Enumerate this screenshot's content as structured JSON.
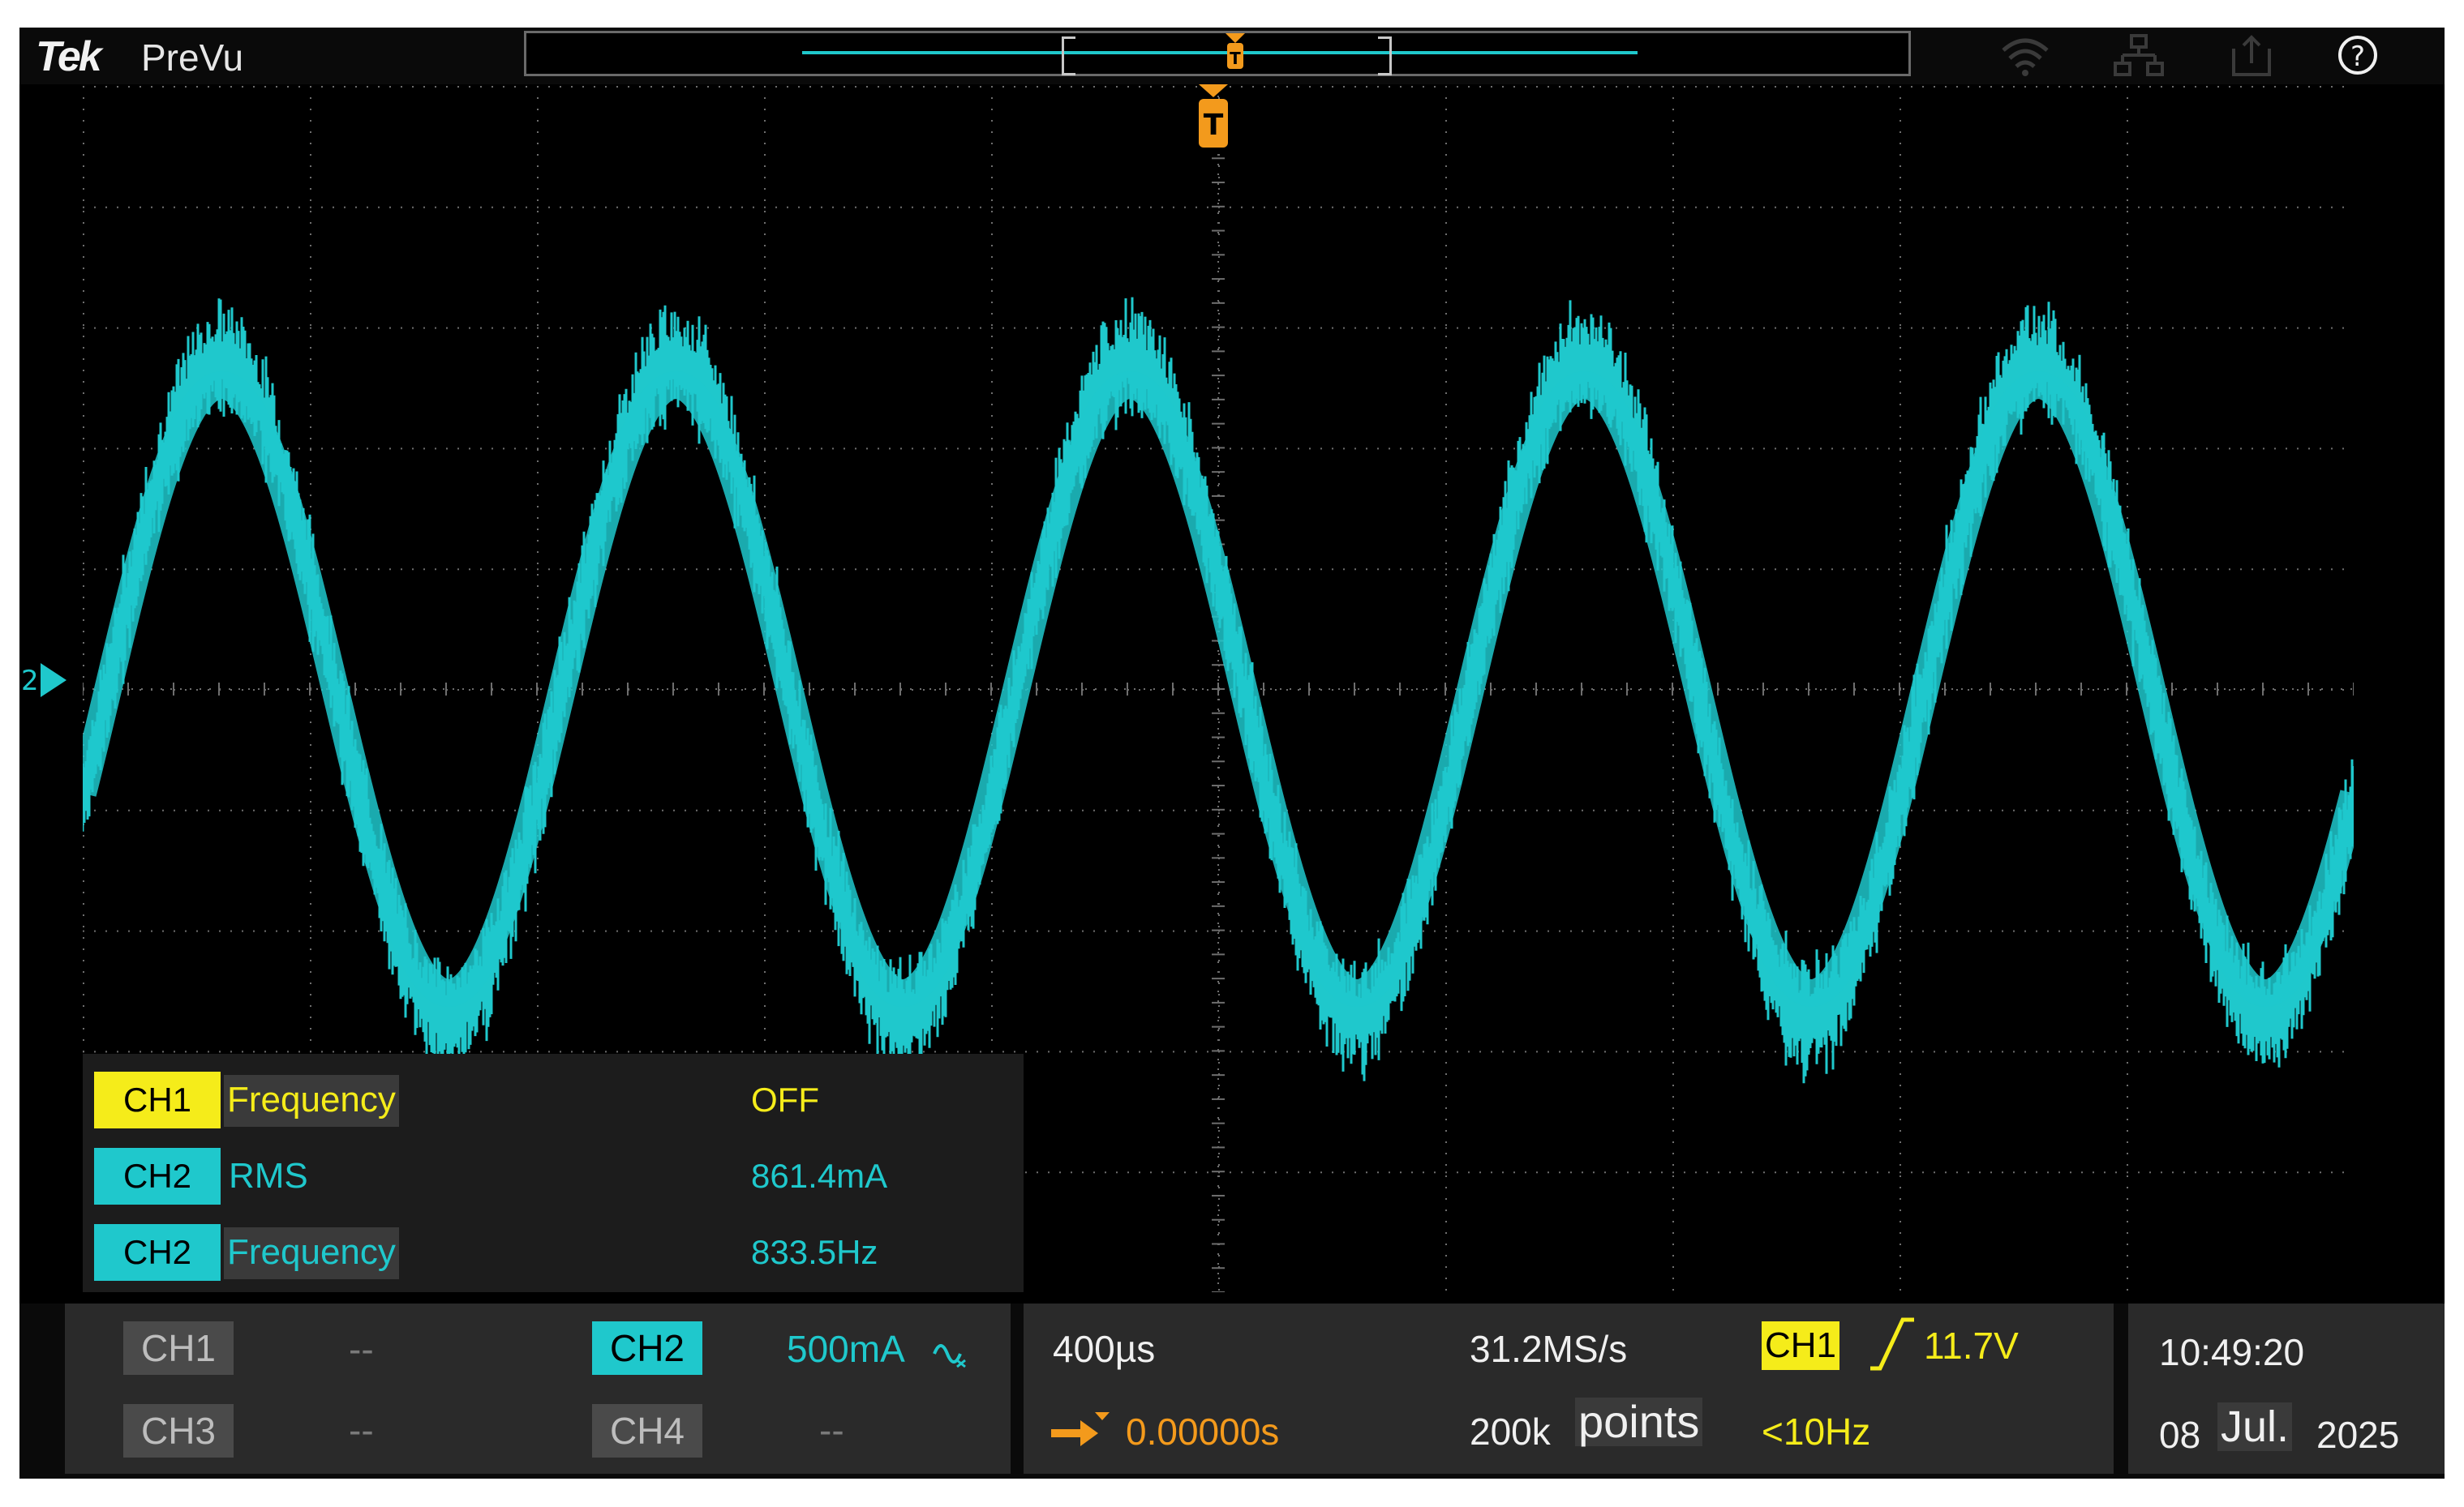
{
  "topbar": {
    "brand": "Tek",
    "mode": "PreVu",
    "icons": [
      "wifi-icon",
      "network-icon",
      "export-icon",
      "help-icon"
    ],
    "help_glyph": "?"
  },
  "trigger": {
    "marker_label": "T"
  },
  "channel_marker": {
    "label": "2"
  },
  "colors": {
    "ch1": "#f5ec1a",
    "ch2": "#1fc8cc",
    "trigger": "#f39a1c",
    "background": "#000000",
    "grid": "#6e6e6e"
  },
  "waveform": {
    "channel": "CH2",
    "frequency_hz": 833.5,
    "rms": "861.4mA"
  },
  "measurements": [
    {
      "channel": "CH1",
      "name": "Frequency",
      "value": "OFF",
      "color": "yellow"
    },
    {
      "channel": "CH2",
      "name": "RMS",
      "value": "861.4mA",
      "color": "cyan"
    },
    {
      "channel": "CH2",
      "name": "Frequency",
      "value": "833.5Hz",
      "color": "cyan"
    }
  ],
  "status": {
    "ch1": {
      "label": "CH1",
      "value": "--"
    },
    "ch2": {
      "label": "CH2",
      "value": "500mA",
      "coupling_icon": "ac-coupling-icon"
    },
    "ch3": {
      "label": "CH3",
      "value": "--"
    },
    "ch4": {
      "label": "CH4",
      "value": "--"
    },
    "horizontal": {
      "timebase": "400µs",
      "sample_rate": "31.2MS/s",
      "delay": "0.00000s",
      "record_points": "200k",
      "record_label": "points"
    },
    "trigger": {
      "source": "CH1",
      "level": "11.7V",
      "frequency": "<10Hz"
    },
    "time": {
      "clock": "10:49:20",
      "day": "08",
      "month": "Jul.",
      "year": "2025"
    }
  }
}
